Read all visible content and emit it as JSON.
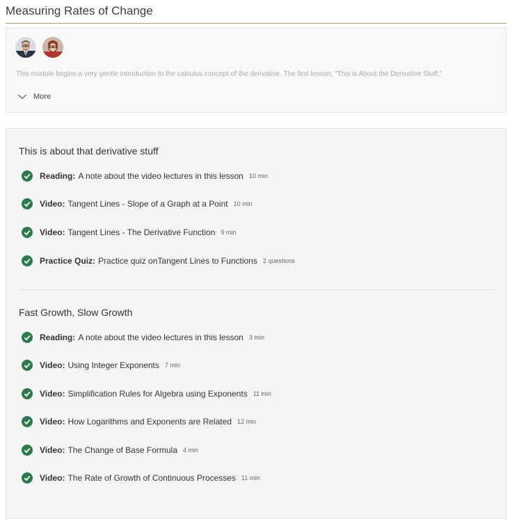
{
  "module": {
    "title": "Measuring Rates of Change"
  },
  "info": {
    "description": "This module begins a very gentle introduction to the calculus concept of the derivative. The first lesson, \"This is About the Derivative Stuff,\"",
    "more_label": "More",
    "instructors": [
      {
        "icon": "instructor-avatar-1"
      },
      {
        "icon": "instructor-avatar-2"
      }
    ]
  },
  "colors": {
    "accent_rule": "#b5975a",
    "complete_check": "#2a7a4b"
  },
  "lessons": [
    {
      "title": "This is about that derivative stuff",
      "items": [
        {
          "type": "Reading:",
          "name": "A note about the video lectures in this lesson",
          "meta": "10 min",
          "status": "completed"
        },
        {
          "type": "Video:",
          "name": "Tangent Lines - Slope of a Graph at a Point",
          "meta": "10 min",
          "status": "completed"
        },
        {
          "type": "Video:",
          "name": "Tangent Lines - The Derivative Function",
          "meta": "9 min",
          "status": "completed"
        },
        {
          "type": "Practice Quiz:",
          "name": "Practice quiz onTangent Lines to Functions",
          "meta": "2 questions",
          "status": "completed"
        }
      ]
    },
    {
      "title": "Fast Growth, Slow Growth",
      "items": [
        {
          "type": "Reading:",
          "name": "A note about the video lectures in this lesson",
          "meta": "3 min",
          "status": "completed"
        },
        {
          "type": "Video:",
          "name": "Using Integer Exponents",
          "meta": "7 min",
          "status": "completed"
        },
        {
          "type": "Video:",
          "name": "Simplification Rules for Algebra using Exponents",
          "meta": "11 min",
          "status": "completed"
        },
        {
          "type": "Video:",
          "name": "How Logarithms and Exponents are Related",
          "meta": "12 min",
          "status": "completed"
        },
        {
          "type": "Video:",
          "name": "The Change of Base Formula",
          "meta": "4 min",
          "status": "completed"
        },
        {
          "type": "Video:",
          "name": "The Rate of Growth of Continuous Processes",
          "meta": "11 min",
          "status": "completed"
        }
      ]
    }
  ]
}
